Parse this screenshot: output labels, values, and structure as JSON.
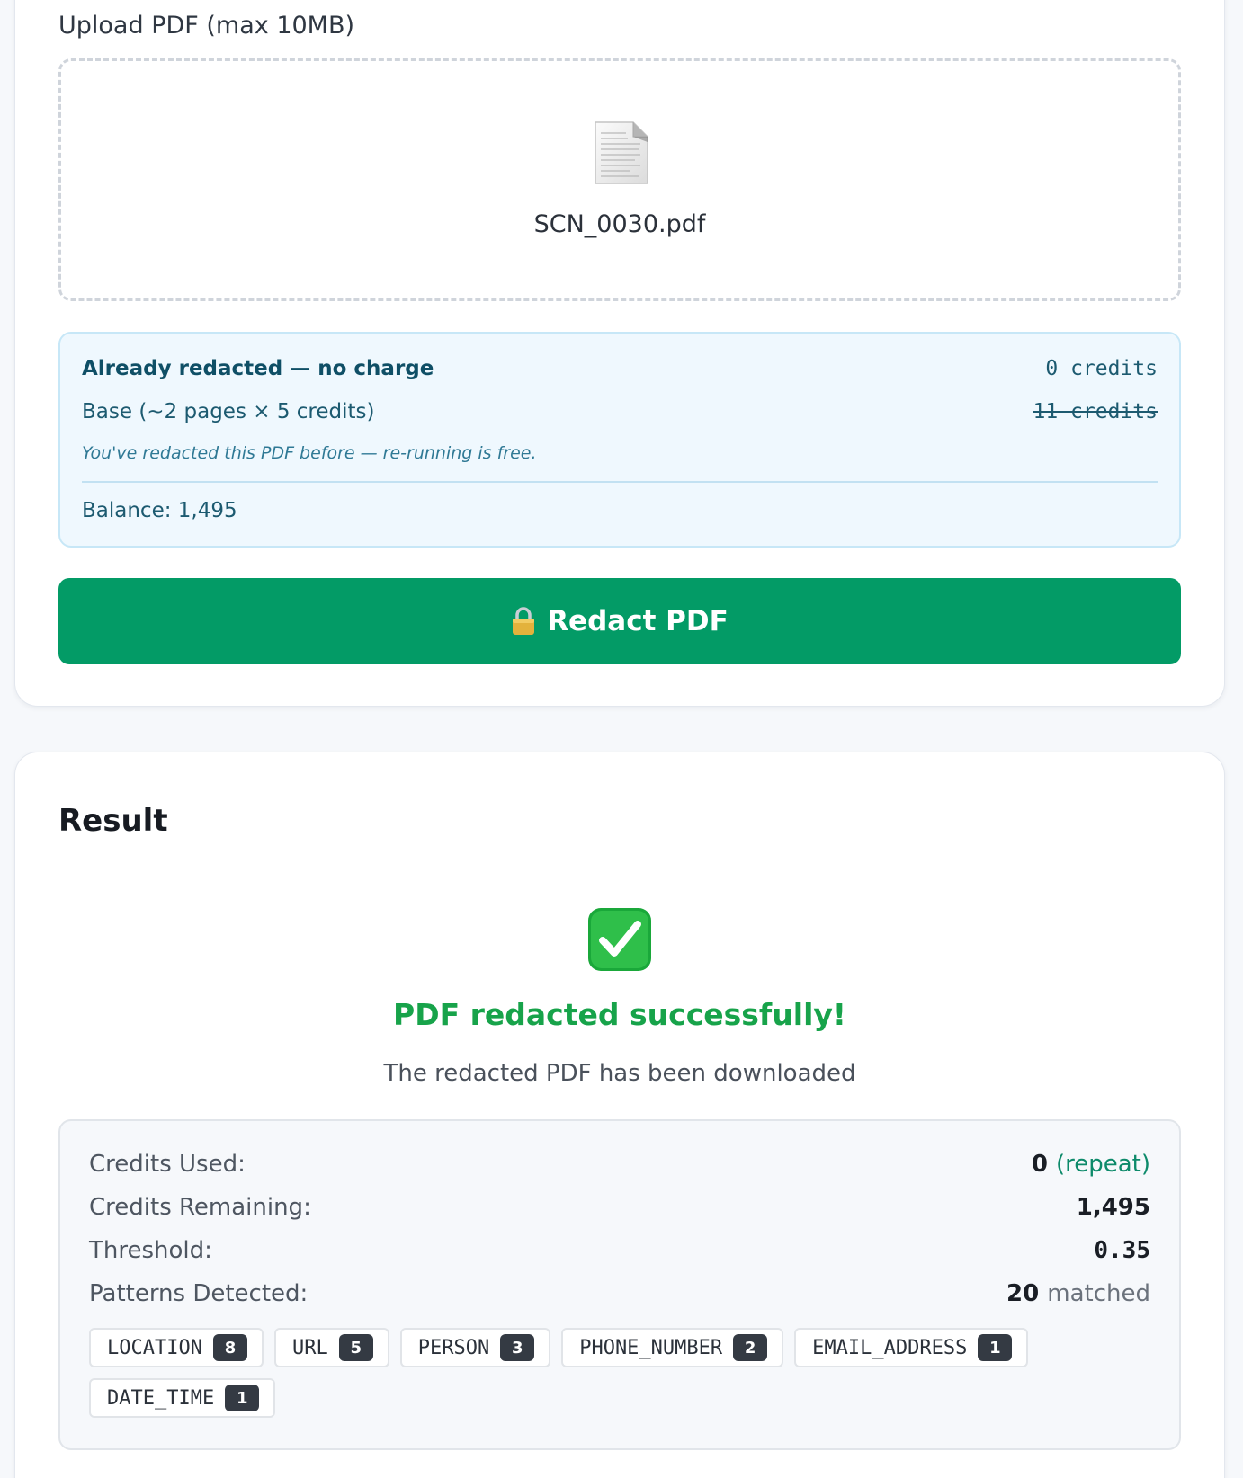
{
  "upload": {
    "label": "Upload PDF (max 10MB)",
    "file_icon": "document-icon",
    "file_name": "SCN_0030.pdf"
  },
  "credit_summary": {
    "title": "Already redacted — no charge",
    "amount": "0 credits",
    "base_label": "Base (~2 pages × 5 credits)",
    "base_amount": "11 credits",
    "note": "You've redacted this PDF before — re-running is free.",
    "balance": "Balance: 1,495"
  },
  "redact_button": {
    "icon": "lock-icon",
    "label": "Redact PDF"
  },
  "result": {
    "title": "Result",
    "status_icon": "check-mark-icon",
    "success_message": "PDF redacted successfully!",
    "sub_message": "The redacted PDF has been downloaded",
    "stats": {
      "credits_used_label": "Credits Used:",
      "credits_used_value": "0",
      "credits_used_note": "(repeat)",
      "credits_remaining_label": "Credits Remaining:",
      "credits_remaining_value": "1,495",
      "threshold_label": "Threshold:",
      "threshold_value": "0.35",
      "patterns_label": "Patterns Detected:",
      "patterns_value": "20",
      "patterns_suffix": "matched"
    },
    "patterns": [
      {
        "name": "LOCATION",
        "count": "8"
      },
      {
        "name": "URL",
        "count": "5"
      },
      {
        "name": "PERSON",
        "count": "3"
      },
      {
        "name": "PHONE_NUMBER",
        "count": "2"
      },
      {
        "name": "EMAIL_ADDRESS",
        "count": "1"
      },
      {
        "name": "DATE_TIME",
        "count": "1"
      }
    ]
  },
  "colors": {
    "accent_green": "#039b66",
    "success_green": "#17a34a",
    "info_bg": "#eff8fe",
    "info_border": "#c7e7f7",
    "badge_dark": "#343a43"
  }
}
